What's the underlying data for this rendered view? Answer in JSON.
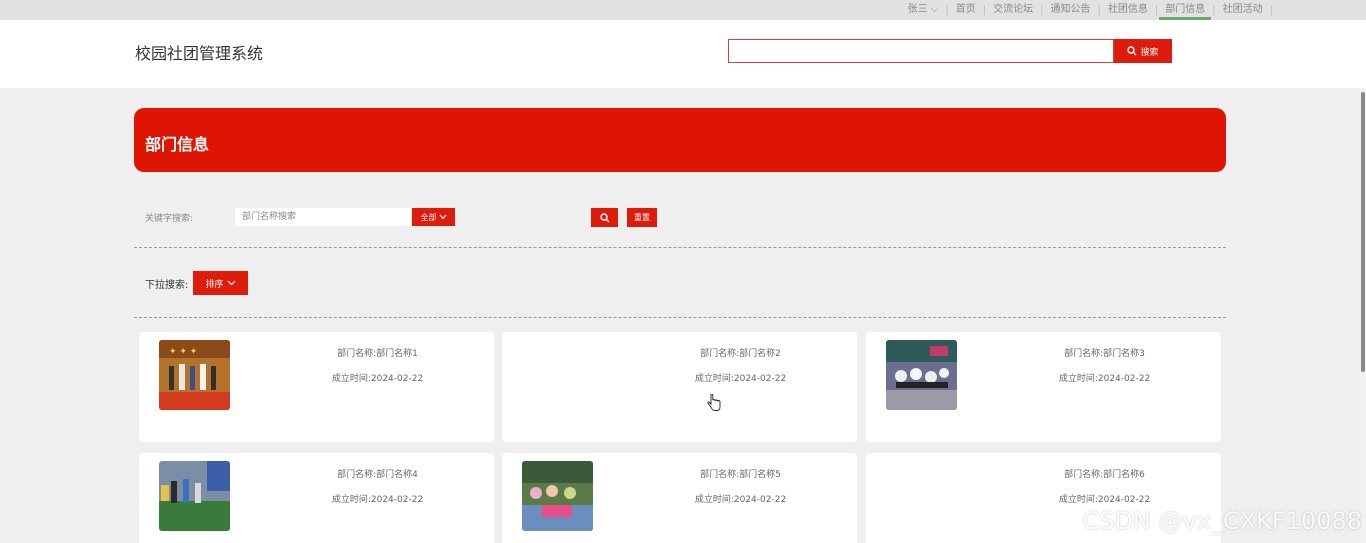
{
  "top_nav": {
    "user": "张三",
    "items": [
      "首页",
      "交流论坛",
      "通知公告",
      "社团信息",
      "部门信息",
      "社团活动"
    ],
    "active_index": 4
  },
  "header": {
    "site_title": "校园社团管理系统",
    "search_value": "",
    "search_button": "搜索"
  },
  "banner": {
    "title": "部门信息"
  },
  "filter": {
    "keyword_label": "关键字搜索:",
    "keyword_placeholder": "部门名称搜索",
    "select_all": "全部",
    "reset": "重置"
  },
  "dropdown": {
    "label": "下拉搜索:",
    "sort_button": "排序"
  },
  "cards": [
    {
      "name": "部门名称:部门名称1",
      "date": "成立时间:2024-02-22",
      "image": "stage-performance"
    },
    {
      "name": "部门名称:部门名称2",
      "date": "成立时间:2024-02-22",
      "image": "none"
    },
    {
      "name": "部门名称:部门名称3",
      "date": "成立时间:2024-02-22",
      "image": "dance-group"
    },
    {
      "name": "部门名称:部门名称4",
      "date": "成立时间:2024-02-22",
      "image": "outdoor-sports"
    },
    {
      "name": "部门名称:部门名称5",
      "date": "成立时间:2024-02-22",
      "image": "outdoor-fair"
    },
    {
      "name": "部门名称:部门名称6",
      "date": "成立时间:2024-02-22",
      "image": "none"
    }
  ],
  "watermark": "CSDN @vx_CXKF10088",
  "colors": {
    "accent": "#de1c0c",
    "banner": "#dd1502",
    "active_underline": "#6aa86a"
  }
}
